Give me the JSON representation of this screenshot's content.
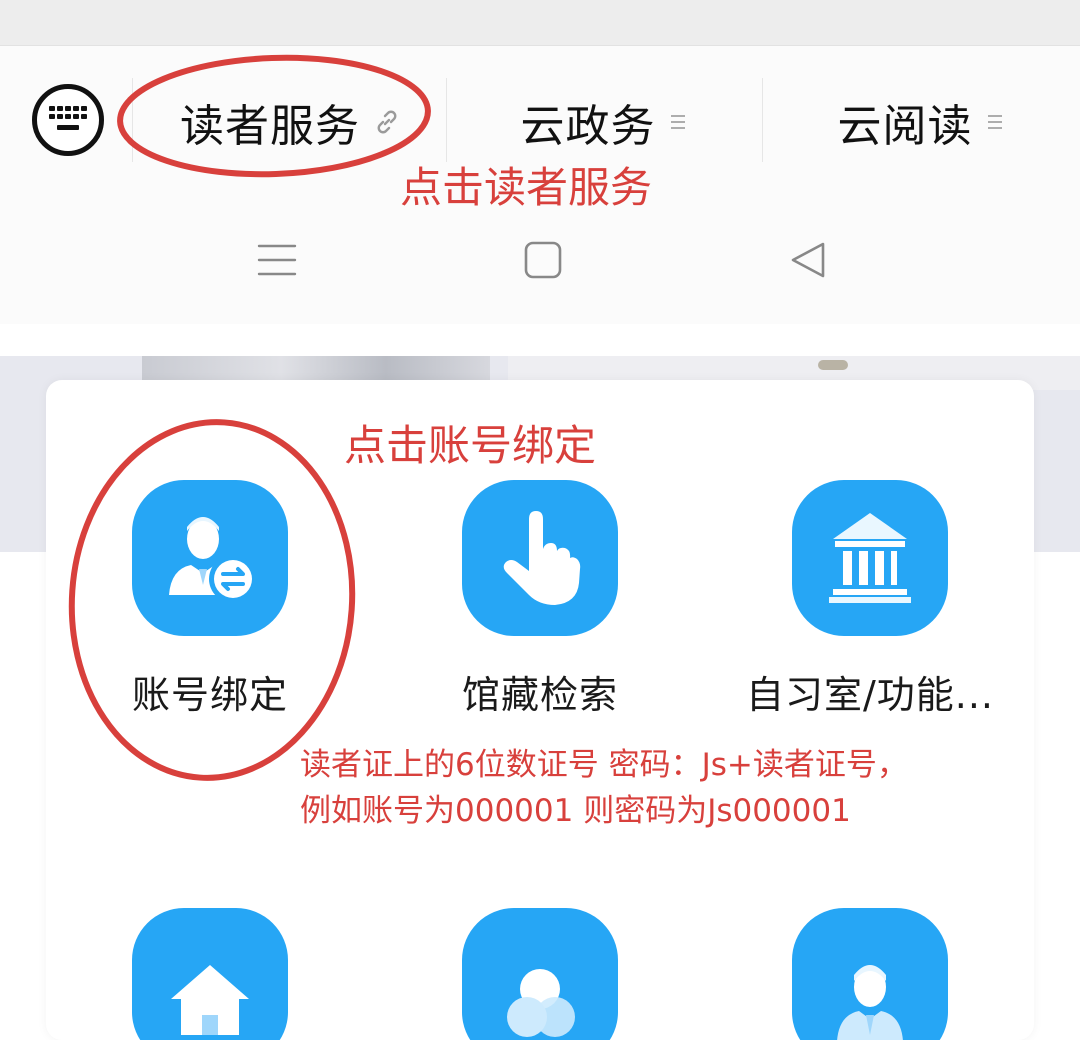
{
  "menu": {
    "tabs": [
      {
        "label": "读者服务",
        "indicator": "link-icon"
      },
      {
        "label": "云政务",
        "indicator": "menu-lines-icon"
      },
      {
        "label": "云阅读",
        "indicator": "menu-lines-icon"
      }
    ],
    "keyboard_toggle": "keyboard-icon"
  },
  "system_nav": {
    "buttons": [
      "recent-apps-icon",
      "home-icon",
      "back-icon"
    ]
  },
  "services": [
    {
      "label": "账号绑定",
      "icon": "account-bind-icon"
    },
    {
      "label": "馆藏检索",
      "icon": "tap-finger-icon"
    },
    {
      "label": "自习室/功能...",
      "icon": "library-building-icon"
    },
    {
      "label": "",
      "icon": "house-icon"
    },
    {
      "label": "",
      "icon": "circles-icon"
    },
    {
      "label": "",
      "icon": "person-icon"
    }
  ],
  "annotations": {
    "step1": "点击读者服务",
    "step2": "点击账号绑定",
    "note_line1": "读者证上的6位数证号 密码：Js+读者证号，",
    "note_line2": "例如账号为000001 则密码为Js000001"
  },
  "colors": {
    "accent_blue": "#26a6f5",
    "annotation_red": "#d8403c"
  }
}
